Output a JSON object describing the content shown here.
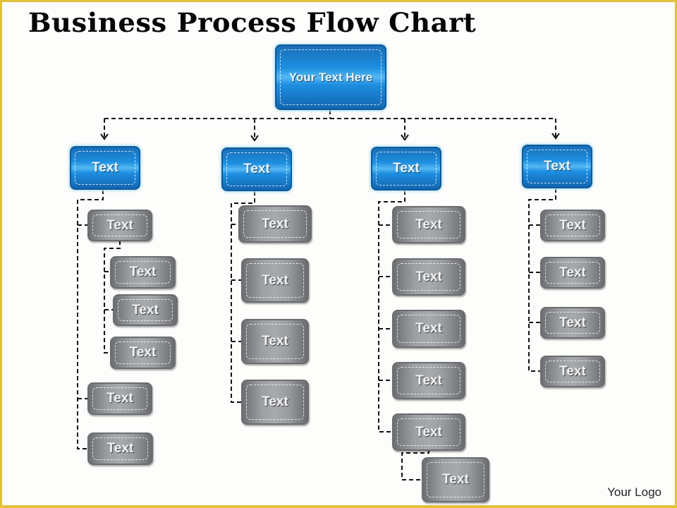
{
  "title": "Business Process Flow Chart",
  "root": {
    "label": "Your Text Here"
  },
  "branches": [
    {
      "label": "Text",
      "children": [
        "Text",
        "Text",
        "Text",
        "Text",
        "Text",
        "Text"
      ]
    },
    {
      "label": "Text",
      "children": [
        "Text",
        "Text",
        "Text",
        "Text"
      ]
    },
    {
      "label": "Text",
      "children": [
        "Text",
        "Text",
        "Text",
        "Text",
        "Text",
        "Text"
      ]
    },
    {
      "label": "Text",
      "children": [
        "Text",
        "Text",
        "Text",
        "Text"
      ]
    }
  ],
  "footer": {
    "logo": "Your Logo"
  },
  "colors": {
    "accent_blue": "#1d8fe0",
    "box_gray": "#9da0a3",
    "frame": "#e2c23a"
  }
}
